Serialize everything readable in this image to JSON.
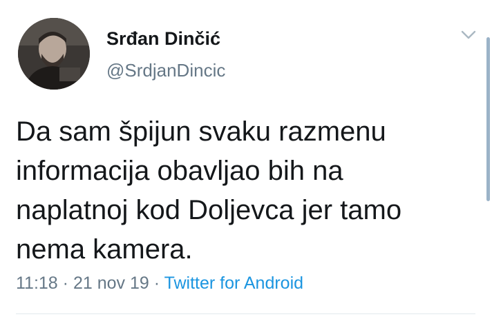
{
  "author": {
    "display_name": "Srđan Dinčić",
    "handle": "@SrdjanDincic",
    "avatar_icon": "user-photo-avatar"
  },
  "tweet": {
    "text_lines": [
      "Da sam špijun svaku razmenu",
      "informacija obavljao bih na",
      "naplatnoj kod Doljevca jer tamo",
      "nema kamera."
    ],
    "time": "11:18",
    "date": "21 nov 19",
    "separator": "·",
    "source": "Twitter for Android"
  },
  "icons": {
    "menu": "chevron-down-icon"
  },
  "colors": {
    "text": "#14171a",
    "muted": "#657786",
    "link": "#1b95e0",
    "divider": "#e1e8ed"
  }
}
